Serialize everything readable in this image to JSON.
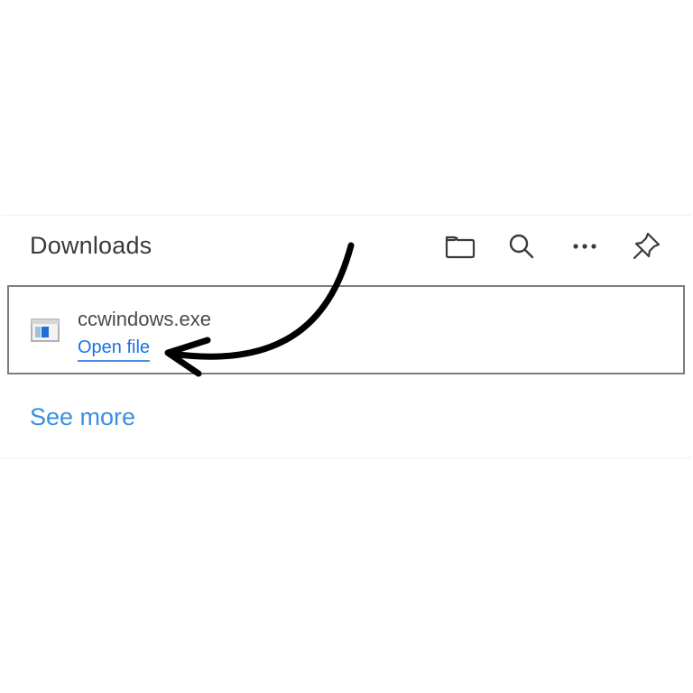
{
  "panel": {
    "title": "Downloads",
    "toolbar": [
      {
        "name": "folder-icon",
        "label": "Open downloads folder"
      },
      {
        "name": "search-icon",
        "label": "Search downloads"
      },
      {
        "name": "more-icon",
        "label": "More options"
      },
      {
        "name": "pin-icon",
        "label": "Pin to toolbar"
      }
    ]
  },
  "download_item": {
    "icon": "exe-file-icon",
    "file_name": "ccwindows.exe",
    "action_label": "Open file"
  },
  "footer": {
    "see_more_label": "See more"
  },
  "annotation": {
    "icon": "curved-arrow-icon"
  },
  "colors": {
    "link": "#1a73e8",
    "see_more": "#3b8fe0",
    "border": "#7d7d7d",
    "title": "#3a3a3a",
    "arrow": "#000000"
  }
}
